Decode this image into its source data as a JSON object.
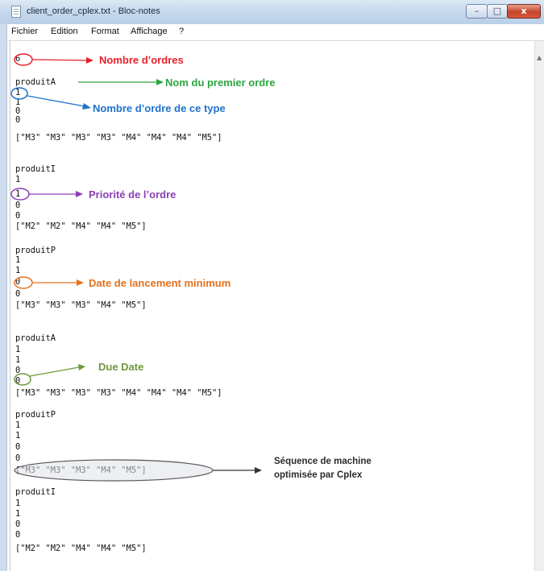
{
  "window": {
    "title": "client_order_cplex.txt - Bloc-notes",
    "controls": {
      "minimize": "–",
      "maximize": "□",
      "close": "x"
    }
  },
  "menu": [
    "Fichier",
    "Edition",
    "Format",
    "Affichage",
    "?"
  ],
  "lines": [
    {
      "text": "6"
    },
    {
      "text": "produitA"
    },
    {
      "text": "1"
    },
    {
      "text": "1"
    },
    {
      "text": "0"
    },
    {
      "text": "0"
    },
    {
      "text": "[\"M3\" \"M3\" \"M3\" \"M3\" \"M4\" \"M4\" \"M4\" \"M5\"]"
    },
    {
      "text": "produitI"
    },
    {
      "text": "1"
    },
    {
      "text": "1"
    },
    {
      "text": "0"
    },
    {
      "text": "0"
    },
    {
      "text": "[\"M2\" \"M2\" \"M4\" \"M4\" \"M5\"]"
    },
    {
      "text": "produitP"
    },
    {
      "text": "1"
    },
    {
      "text": "1"
    },
    {
      "text": "0"
    },
    {
      "text": "0"
    },
    {
      "text": "[\"M3\" \"M3\" \"M3\" \"M4\" \"M5\"]"
    },
    {
      "text": "produitA"
    },
    {
      "text": "1"
    },
    {
      "text": "1"
    },
    {
      "text": "0"
    },
    {
      "text": "0"
    },
    {
      "text": "[\"M3\" \"M3\" \"M3\" \"M3\" \"M4\" \"M4\" \"M4\" \"M5\"]"
    },
    {
      "text": "produitP"
    },
    {
      "text": "1"
    },
    {
      "text": "1"
    },
    {
      "text": "0"
    },
    {
      "text": "0"
    },
    {
      "text": "[\"M3\" \"M3\" \"M3\" \"M4\" \"M5\"]"
    },
    {
      "text": "produitI"
    },
    {
      "text": "1"
    },
    {
      "text": "1"
    },
    {
      "text": "0"
    },
    {
      "text": "0"
    },
    {
      "text": "[\"M2\" \"M2\" \"M4\" \"M4\" \"M5\"]"
    }
  ],
  "annotations": {
    "nombre_ordres": "Nombre d’ordres",
    "nom_premier_ordre": "Nom du premier ordre",
    "nombre_ordre_type": "Nombre d’ordre de ce type",
    "priorite": "Priorité de l’ordre",
    "date_lancement": "Date de lancement minimum",
    "due_date": "Due Date",
    "sequence_1": "Séquence de machine",
    "sequence_2": "optimisée par Cplex"
  },
  "annotation_colors": {
    "red": "#e8202a",
    "green": "#2ea53f",
    "blue": "#1e72c9",
    "purple": "#8b3fb6",
    "orange": "#e2711f",
    "olive": "#6f9a3b",
    "dark": "#2b2b2b"
  }
}
